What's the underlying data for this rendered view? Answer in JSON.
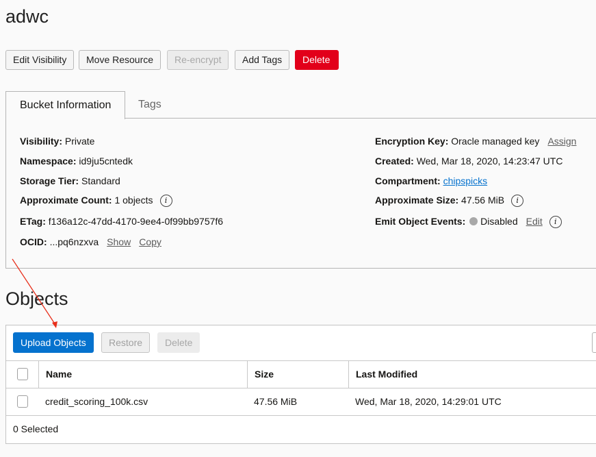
{
  "title": "adwc",
  "actions": {
    "edit_visibility": "Edit Visibility",
    "move_resource": "Move Resource",
    "reencrypt": "Re-encrypt",
    "add_tags": "Add Tags",
    "delete": "Delete"
  },
  "tabs": [
    "Bucket Information",
    "Tags"
  ],
  "info": {
    "visibility": {
      "label": "Visibility:",
      "value": "Private"
    },
    "namespace": {
      "label": "Namespace:",
      "value": "id9ju5cntedk"
    },
    "storage_tier": {
      "label": "Storage Tier:",
      "value": "Standard"
    },
    "approx_count": {
      "label": "Approximate Count:",
      "value": "1 objects"
    },
    "etag": {
      "label": "ETag:",
      "value": "f136a12c-47dd-4170-9ee4-0f99bb9757f6"
    },
    "ocid": {
      "label": "OCID:",
      "value": "...pq6nzxva",
      "show": "Show",
      "copy": "Copy"
    },
    "encryption_key": {
      "label": "Encryption Key:",
      "value": "Oracle managed key",
      "assign": "Assign"
    },
    "created": {
      "label": "Created:",
      "value": "Wed, Mar 18, 2020, 14:23:47 UTC"
    },
    "compartment": {
      "label": "Compartment:",
      "value": "chipspicks"
    },
    "approx_size": {
      "label": "Approximate Size:",
      "value": "47.56 MiB"
    },
    "emit_events": {
      "label": "Emit Object Events:",
      "value": "Disabled",
      "edit": "Edit",
      "status_color": "#a8a8a8"
    }
  },
  "objects": {
    "heading": "Objects",
    "upload": "Upload Objects",
    "restore": "Restore",
    "delete": "Delete",
    "columns": [
      "Name",
      "Size",
      "Last Modified"
    ],
    "rows": [
      {
        "name": "credit_scoring_100k.csv",
        "size": "47.56 MiB",
        "modified": "Wed, Mar 18, 2020, 14:29:01 UTC"
      }
    ],
    "selected": "0 Selected"
  },
  "colors": {
    "primary": "#0572ce",
    "danger": "#e2001a",
    "annotation_arrow": "#e8301c"
  }
}
